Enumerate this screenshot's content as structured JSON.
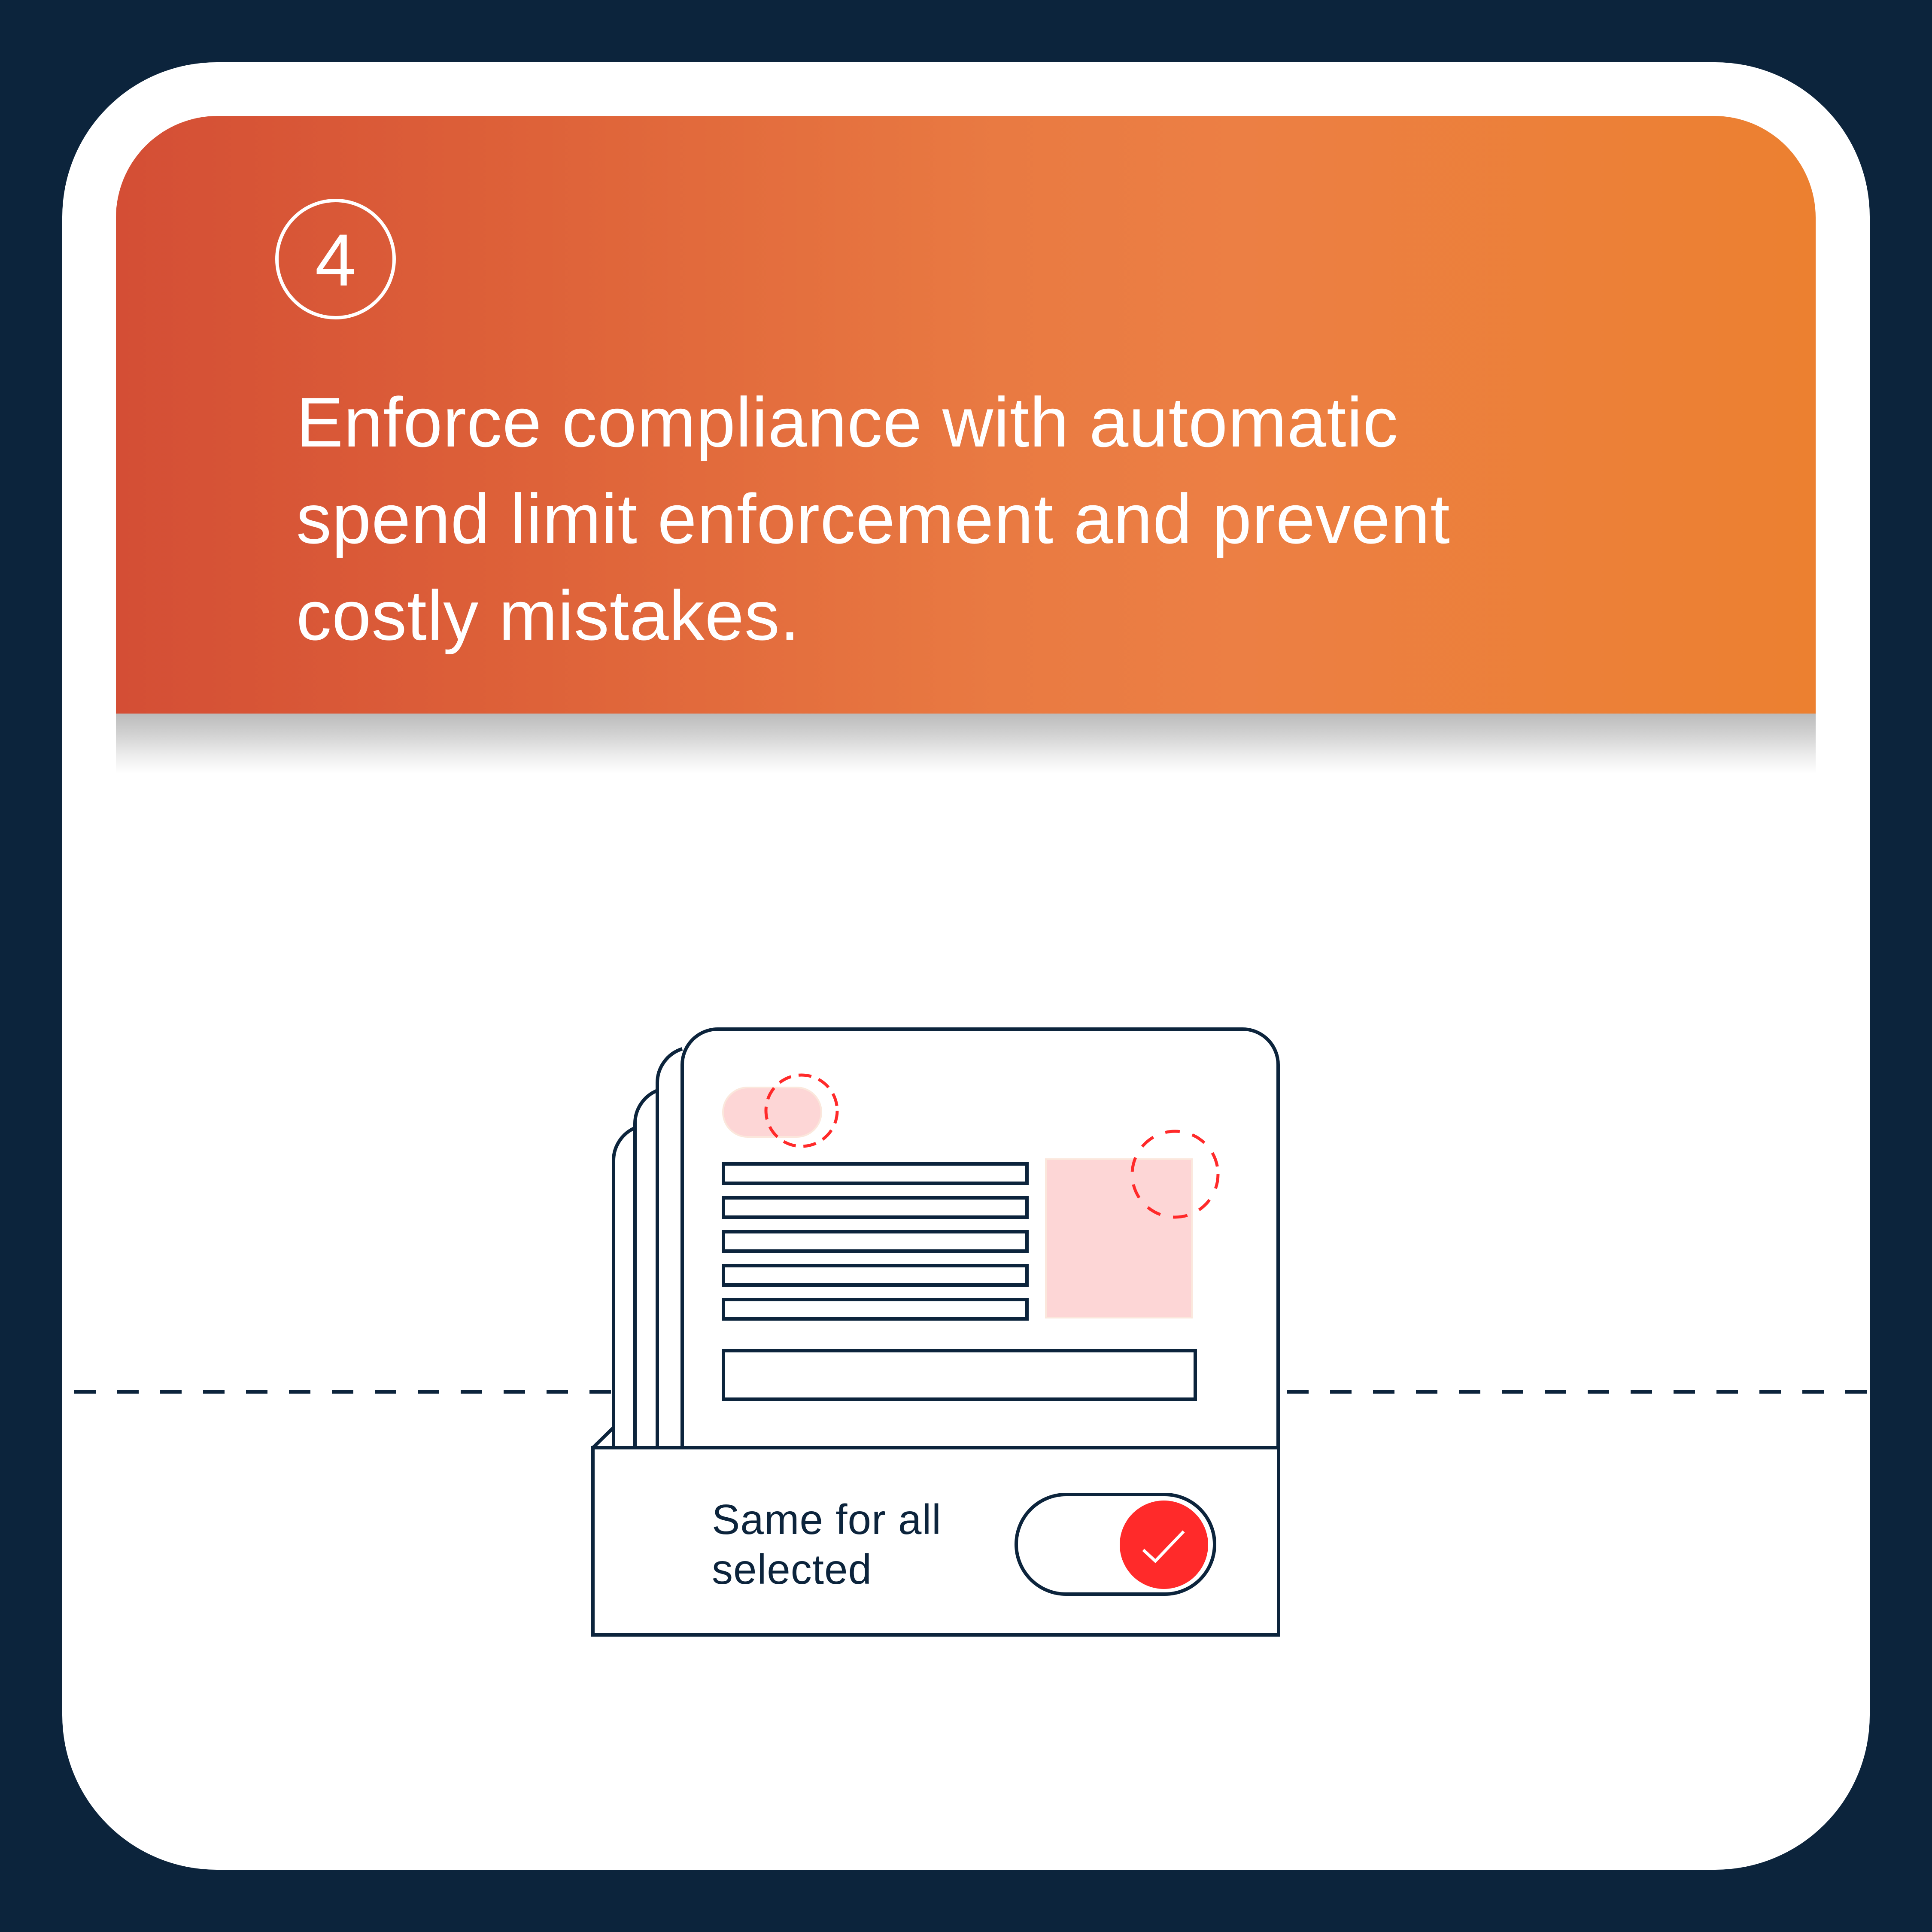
{
  "colors": {
    "background": "#0C243C",
    "card": "#FFFFFF",
    "header_gradient_start": "#D44E35",
    "header_gradient_mid": "#EC7F44",
    "header_gradient_end": "#EC8030",
    "outline": "#0C243C",
    "accent_red": "#FF2A2A",
    "highlight_pink": "#FDD6D6"
  },
  "header": {
    "step_number": "4",
    "headline_lines": [
      "Enforce compliance with automatic",
      "spend limit enforcement and prevent",
      "costly mistakes."
    ]
  },
  "illustration": {
    "form_rows": 5,
    "toggle": {
      "label_lines": [
        "Same for all",
        "selected"
      ],
      "state": "on",
      "knob_icon": "checkmark-icon"
    }
  }
}
